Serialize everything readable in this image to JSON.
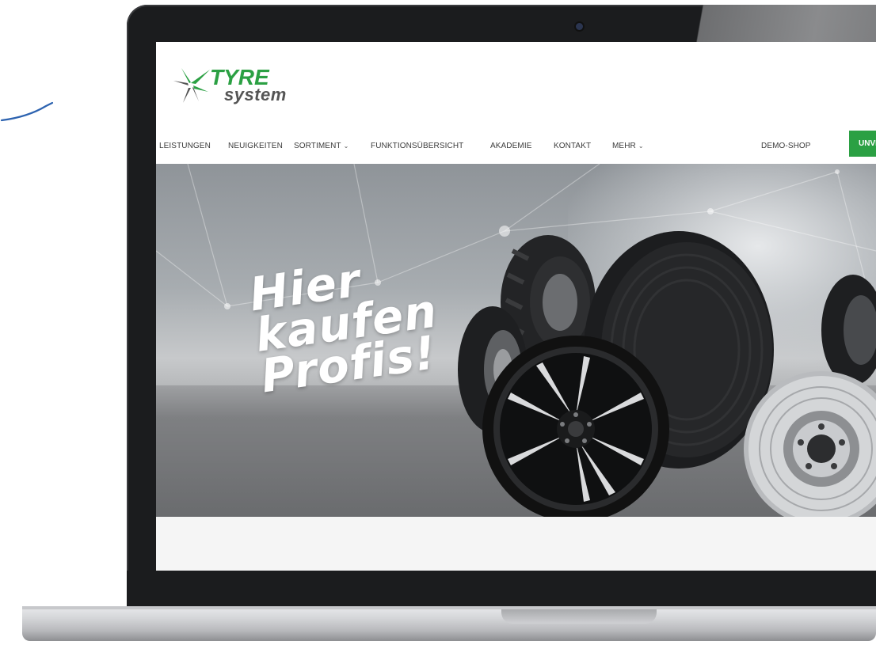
{
  "brand": {
    "logo_line1": "TYRE",
    "logo_line2": "system",
    "accent_color": "#2ba043"
  },
  "nav": {
    "items": [
      {
        "label": "LEISTUNGEN"
      },
      {
        "label": "NEUIGKEITEN"
      },
      {
        "label": "SORTIMENT",
        "dropdown": true
      },
      {
        "label": "FUNKTIONSÜBERSICHT"
      },
      {
        "label": "AKADEMIE"
      },
      {
        "label": "KONTAKT"
      },
      {
        "label": "MEHR",
        "dropdown": true
      }
    ],
    "demo_shop": "DEMO-SHOP",
    "cta": "UNVERB"
  },
  "hero": {
    "headline_line1": "Hier",
    "headline_line2": "kaufen",
    "headline_line3": "Profis!",
    "image_subject": "tyres, alloy rim and brake disc"
  },
  "icons": {
    "dropdown": "chevron-down-icon",
    "logo": "pinwheel-tyre-logo-icon"
  }
}
